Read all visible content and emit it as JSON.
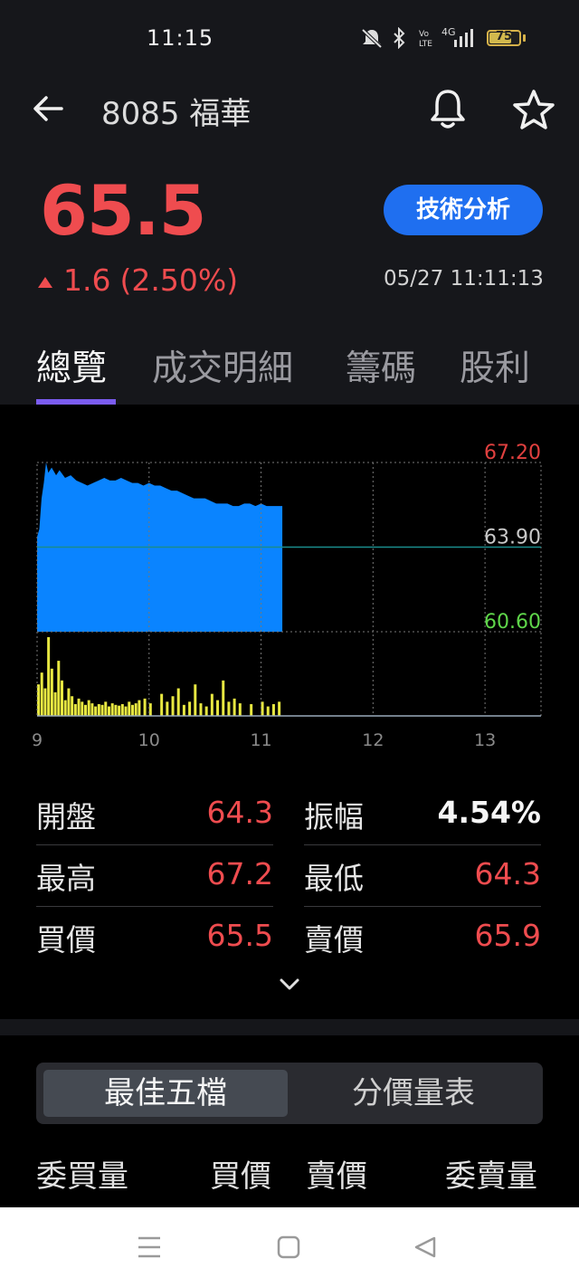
{
  "status_bar": {
    "time": "11:15",
    "network": "4G",
    "battery": "75",
    "battery_level": 0.75
  },
  "header": {
    "stock_code": "8085",
    "stock_name": "福華",
    "back_icon": "back-arrow-icon",
    "bell_icon": "bell-icon",
    "star_icon": "star-icon"
  },
  "quote": {
    "price": "65.5",
    "change": "1.6",
    "change_pct": "(2.50%)",
    "datetime": "05/27 11:11:13",
    "tech_button": "技術分析",
    "up_color": "#ef4c4f"
  },
  "tabs": [
    "總覽",
    "成交明細",
    "籌碼",
    "股利"
  ],
  "chart_data": {
    "type": "area",
    "title": "",
    "price_series": {
      "name": "",
      "x": [
        9.0,
        9.02,
        9.04,
        9.06,
        9.08,
        9.1,
        9.13,
        9.17,
        9.2,
        9.25,
        9.3,
        9.35,
        9.4,
        9.45,
        9.5,
        9.55,
        9.6,
        9.65,
        9.7,
        9.75,
        9.8,
        9.85,
        9.9,
        9.95,
        10.0,
        10.05,
        10.1,
        10.15,
        10.2,
        10.25,
        10.3,
        10.35,
        10.4,
        10.45,
        10.5,
        10.55,
        10.6,
        10.65,
        10.7,
        10.75,
        10.8,
        10.85,
        10.9,
        10.95,
        11.0,
        11.05,
        11.1,
        11.15,
        11.19
      ],
      "values": [
        64.3,
        64.6,
        65.8,
        66.4,
        67.2,
        66.8,
        67.0,
        66.7,
        66.9,
        66.6,
        66.7,
        66.5,
        66.4,
        66.3,
        66.4,
        66.5,
        66.6,
        66.5,
        66.5,
        66.6,
        66.5,
        66.4,
        66.4,
        66.3,
        66.4,
        66.3,
        66.3,
        66.2,
        66.1,
        66.1,
        66.0,
        65.9,
        65.8,
        65.8,
        65.8,
        65.7,
        65.6,
        65.6,
        65.6,
        65.5,
        65.5,
        65.6,
        65.6,
        65.5,
        65.6,
        65.5,
        65.5,
        65.5,
        65.5
      ]
    },
    "volume_series": {
      "name": "",
      "x": [
        9.0,
        9.03,
        9.06,
        9.09,
        9.12,
        9.15,
        9.18,
        9.21,
        9.24,
        9.27,
        9.3,
        9.33,
        9.36,
        9.39,
        9.42,
        9.45,
        9.48,
        9.51,
        9.54,
        9.57,
        9.6,
        9.63,
        9.66,
        9.69,
        9.72,
        9.75,
        9.78,
        9.81,
        9.84,
        9.87,
        9.9,
        9.95,
        10.0,
        10.1,
        10.15,
        10.2,
        10.25,
        10.3,
        10.35,
        10.4,
        10.45,
        10.5,
        10.55,
        10.6,
        10.65,
        10.7,
        10.75,
        10.8,
        10.9,
        11.0,
        11.05,
        11.1,
        11.15
      ],
      "values": [
        40,
        55,
        35,
        100,
        60,
        30,
        70,
        45,
        20,
        35,
        25,
        15,
        22,
        18,
        14,
        20,
        16,
        12,
        15,
        14,
        18,
        12,
        16,
        14,
        13,
        15,
        12,
        18,
        14,
        16,
        20,
        22,
        16,
        28,
        18,
        25,
        35,
        14,
        18,
        40,
        16,
        12,
        28,
        20,
        45,
        18,
        22,
        16,
        15,
        18,
        12,
        15,
        18
      ]
    },
    "y_ticks": [
      "67.20",
      "63.90",
      "60.60"
    ],
    "ylim": [
      60.6,
      67.2
    ],
    "reference": 63.9,
    "x_ticks": [
      "9",
      "10",
      "11",
      "12",
      "13"
    ],
    "xlim": [
      9,
      13.5
    ],
    "colors": {
      "area": "#0a84ff",
      "volume": "#e7e741",
      "ref_line": "#1a8c8c",
      "grid": "#777777",
      "up": "#e0403f",
      "flat": "#c8c8c8",
      "down": "#5fd64a"
    }
  },
  "stats": {
    "open_label": "開盤",
    "open": "64.3",
    "amp_label": "振幅",
    "amp": "4.54%",
    "high_label": "最高",
    "high": "67.2",
    "low_label": "最低",
    "low": "64.3",
    "bid_label": "買價",
    "bid": "65.5",
    "ask_label": "賣價",
    "ask": "65.9"
  },
  "segment": {
    "best5": "最佳五檔",
    "price_volume": "分價量表"
  },
  "columns": {
    "bid_qty": "委買量",
    "bid_price": "買價",
    "ask_price": "賣價",
    "ask_qty": "委賣量"
  }
}
